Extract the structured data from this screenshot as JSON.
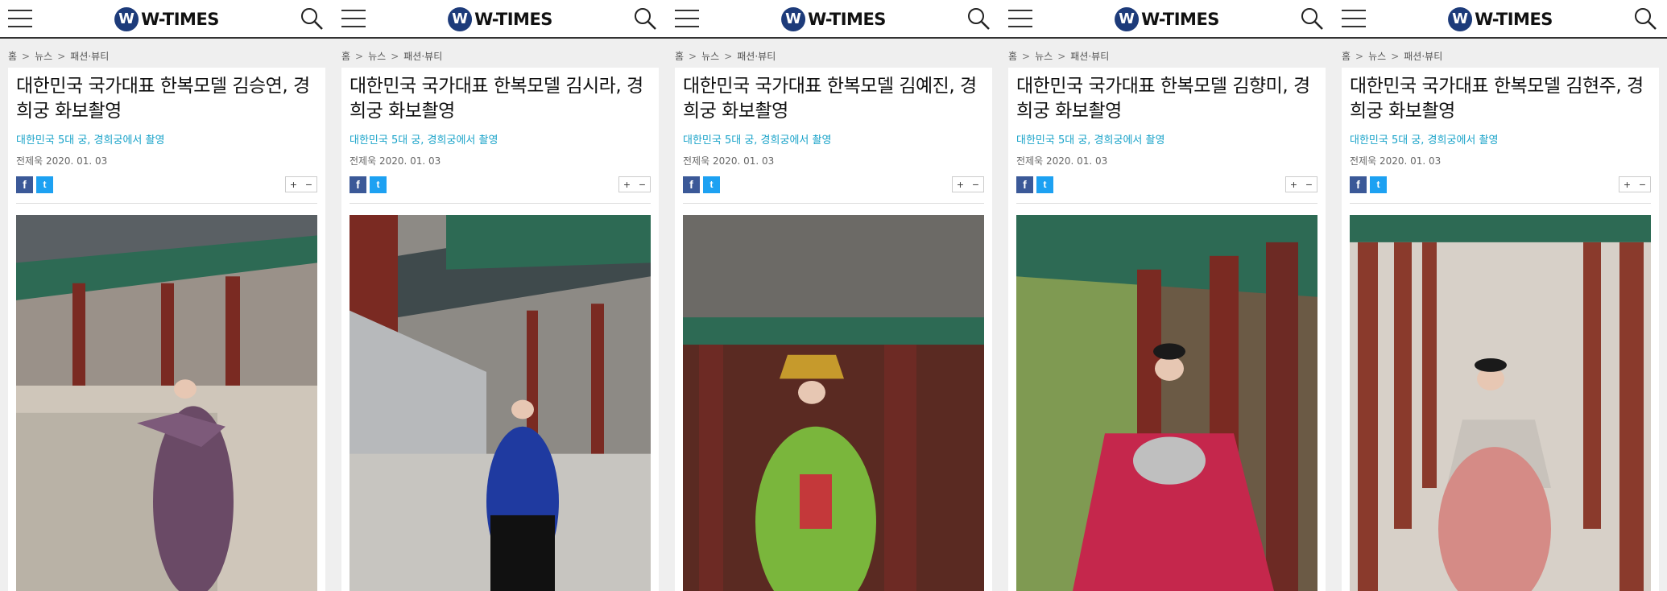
{
  "site": {
    "logo_mark": "W",
    "logo_text": "W-TIMES"
  },
  "breadcrumb": {
    "home": "홈",
    "sep": ">",
    "news": "뉴스",
    "section": "패션·뷰티"
  },
  "icons": {
    "menu": "hamburger-menu-icon",
    "search": "search-icon",
    "facebook": "facebook-icon",
    "twitter": "twitter-icon"
  },
  "share": {
    "facebook_glyph": "f",
    "twitter_glyph": "t"
  },
  "font_controls": {
    "plus": "+",
    "minus": "−"
  },
  "colors": {
    "accent": "#1aa3c9",
    "brand": "#1d3b7a",
    "facebook": "#3b5998",
    "twitter": "#1da1f2"
  },
  "articles": [
    {
      "title": "대한민국 국가대표 한복모델 김승연, 경희궁 화보촬영",
      "subtitle": "대한민국 5대 궁, 경희궁에서 촬영",
      "author": "전제욱",
      "date": "2020. 01. 03",
      "photo": "model-in-purple-hanbok-with-palace"
    },
    {
      "title": "대한민국 국가대표 한복모델 김시라, 경희궁 화보촬영",
      "subtitle": "대한민국 5대 궁, 경희궁에서 촬영",
      "author": "전제욱",
      "date": "2020. 01. 03",
      "photo": "model-in-blue-hanbok-by-wall"
    },
    {
      "title": "대한민국 국가대표 한복모델 김예진, 경희궁 화보촬영",
      "subtitle": "대한민국 5대 궁, 경희궁에서 촬영",
      "author": "전제욱",
      "date": "2020. 01. 03",
      "photo": "model-in-green-royal-hanbok"
    },
    {
      "title": "대한민국 국가대표 한복모델 김향미, 경희궁 화보촬영",
      "subtitle": "대한민국 5대 궁, 경희궁에서 촬영",
      "author": "전제욱",
      "date": "2020. 01. 03",
      "photo": "model-in-red-hanbok-with-pillars"
    },
    {
      "title": "대한민국 국가대표 한복모델 김현주, 경희궁 화보촬영",
      "subtitle": "대한민국 5대 궁, 경희궁에서 촬영",
      "author": "전제욱",
      "date": "2020. 01. 03",
      "photo": "model-in-pink-hanbok-in-corridor"
    }
  ]
}
